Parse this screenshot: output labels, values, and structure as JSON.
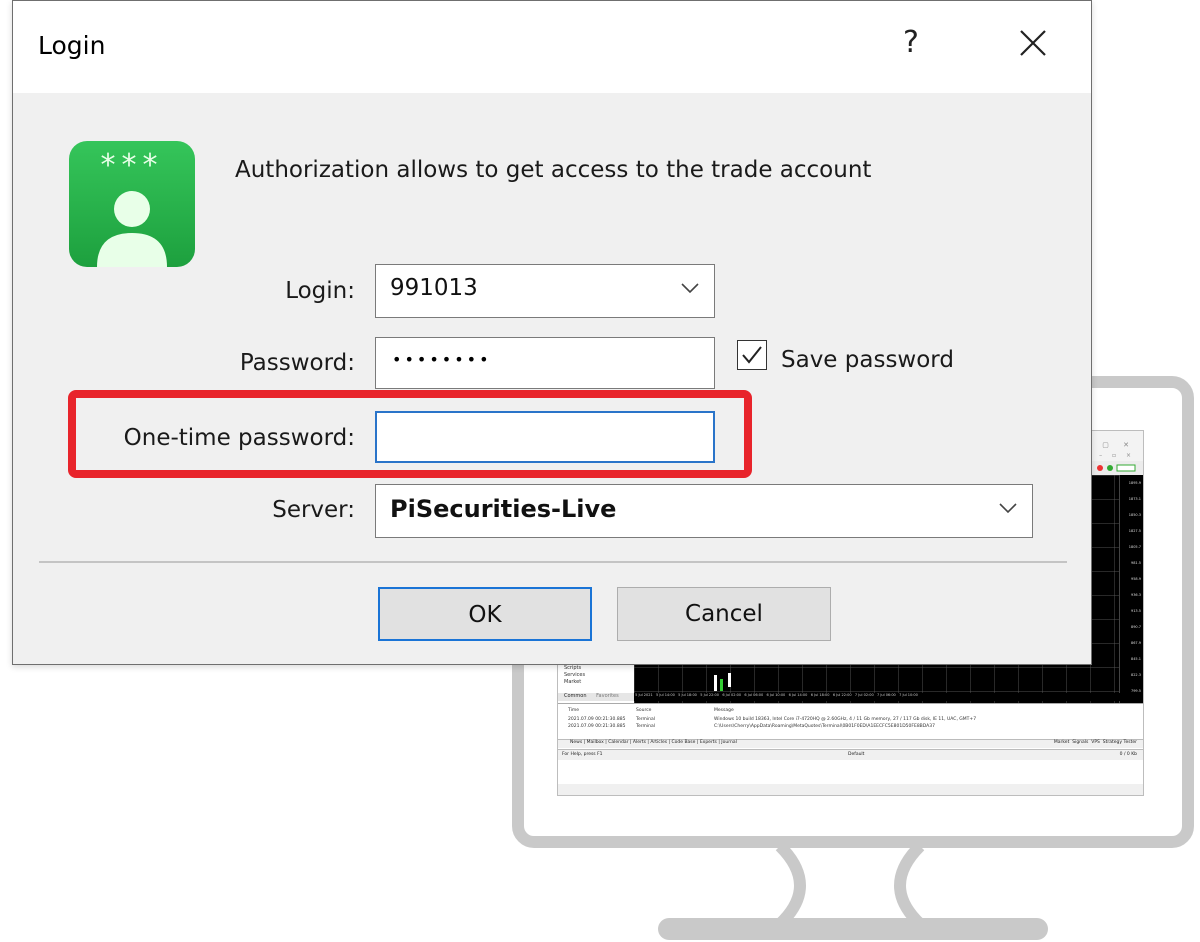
{
  "dialog": {
    "title": "Login",
    "help_glyph": "?",
    "close_icon": "close-icon",
    "info_text": "Authorization allows to get access to the trade account",
    "avatar_icon": "account-avatar-icon",
    "avatar_color": "#2db84f",
    "login_label": "Login:",
    "login_value": "991013",
    "password_label": "Password:",
    "password_value": "••••••••",
    "save_password_label": "Save password",
    "save_password_checked": true,
    "otp_label": "One-time password:",
    "otp_value": "",
    "server_label": "Server:",
    "server_value": "PiSecurities-Live",
    "ok_label": "OK",
    "cancel_label": "Cancel",
    "highlight_color": "#e8242b",
    "focus_color": "#2a74c9"
  },
  "screen": {
    "nav_items": [
      "Scripts",
      "Services",
      "Market"
    ],
    "nav_tabs": [
      "Common",
      "Favorites"
    ],
    "journal_headers": [
      "Time",
      "Source",
      "Message"
    ],
    "journal_rows": [
      {
        "time": "2021.07.09 00:21:30.885",
        "source": "Terminal",
        "message": "Windows 10 build 18363, Intel Core i7-4720HQ @ 2.60GHz, 4 / 11 Gb memory, 27 / 117 Gb disk, IE 11, UAC, GMT+7"
      },
      {
        "time": "2021.07.09 00:21:30.885",
        "source": "Terminal",
        "message": "C:\\Users\\Cherry\\AppData\\Roaming\\MetaQuotes\\Terminal\\0B01F0ED\\A1EECFC5E801D50FE8BDA37"
      }
    ],
    "terminal_tabs": [
      "News",
      "Mailbox",
      "Calendar",
      "Alerts",
      "Articles",
      "Code Base",
      "Experts",
      "Journal"
    ],
    "right_tabs": [
      "Market",
      "Signals",
      "VPS",
      "Strategy Tester"
    ],
    "status_left": "For Help, press F1",
    "status_mid": "Default",
    "status_right": "0 / 0 Kb",
    "prices": [
      "1895.9",
      "1873.1",
      "1850.3",
      "1827.5",
      "1805.7",
      "981.5",
      "958.9",
      "936.3",
      "913.5",
      "890.7",
      "867.9",
      "845.1",
      "822.3",
      "799.5",
      "776.7"
    ]
  }
}
